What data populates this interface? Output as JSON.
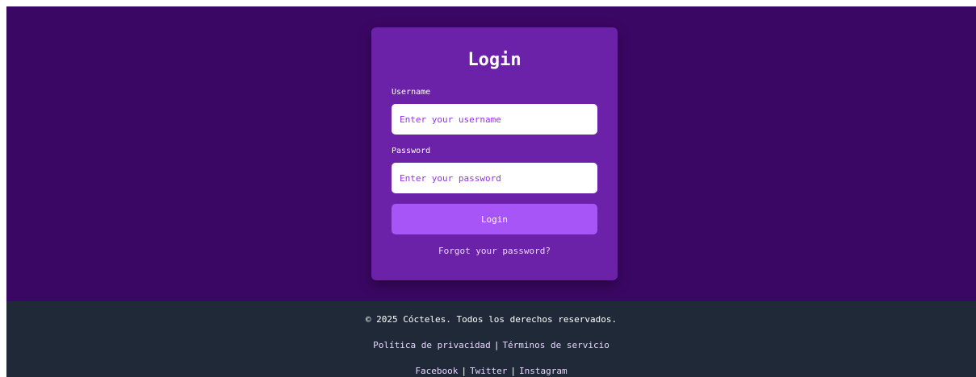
{
  "login": {
    "title": "Login",
    "username_label": "Username",
    "username_placeholder": "Enter your username",
    "password_label": "Password",
    "password_placeholder": "Enter your password",
    "submit_label": "Login",
    "forgot_link": "Forgot your password?"
  },
  "footer": {
    "copyright": "© 2025 Cócteles. Todos los derechos reservados.",
    "legal_links": {
      "privacy": "Política de privacidad",
      "terms": "Términos de servicio",
      "separator": "|"
    },
    "social_links": {
      "facebook": "Facebook",
      "twitter": "Twitter",
      "instagram": "Instagram",
      "separator": "|"
    }
  },
  "colors": {
    "page_background": "#3b0764",
    "card_background": "#6b21a8",
    "button_background": "#a855f7",
    "footer_background": "#1f2937",
    "link_color": "#e9d5ff"
  }
}
